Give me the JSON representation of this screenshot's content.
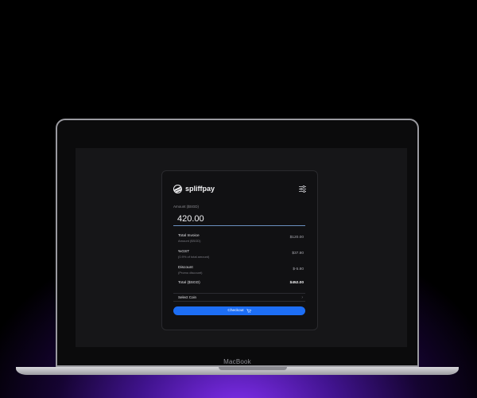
{
  "device": {
    "brand_label": "MacBook"
  },
  "app": {
    "name": "spliffpay",
    "logo_icon": "spliffpay-logo-icon",
    "settings_icon": "sliders-icon"
  },
  "form": {
    "amount_label": "Amount ($SGD)",
    "amount_value": "420.00"
  },
  "summary": {
    "rows": [
      {
        "title": "Total Invoice",
        "subtitle": "Amount ($SGD)",
        "value": "$120.00"
      },
      {
        "title": "%GST",
        "subtitle": "(0.9% of total amount)",
        "value": "$37.80"
      },
      {
        "title": "Discount",
        "subtitle": "(Promo discount)",
        "value": "$-5.80"
      }
    ],
    "total_label": "Total ($SGD)",
    "total_value": "$452.00"
  },
  "coin_select": {
    "label": "Select Coin",
    "chevron_icon": "chevron-right-icon"
  },
  "checkout": {
    "label": "Checkout",
    "icon": "cart-icon"
  },
  "colors": {
    "accent": "#1d6ef5",
    "glow": "#8a32ff",
    "card_bg": "#111113",
    "screen_bg": "#161618"
  }
}
